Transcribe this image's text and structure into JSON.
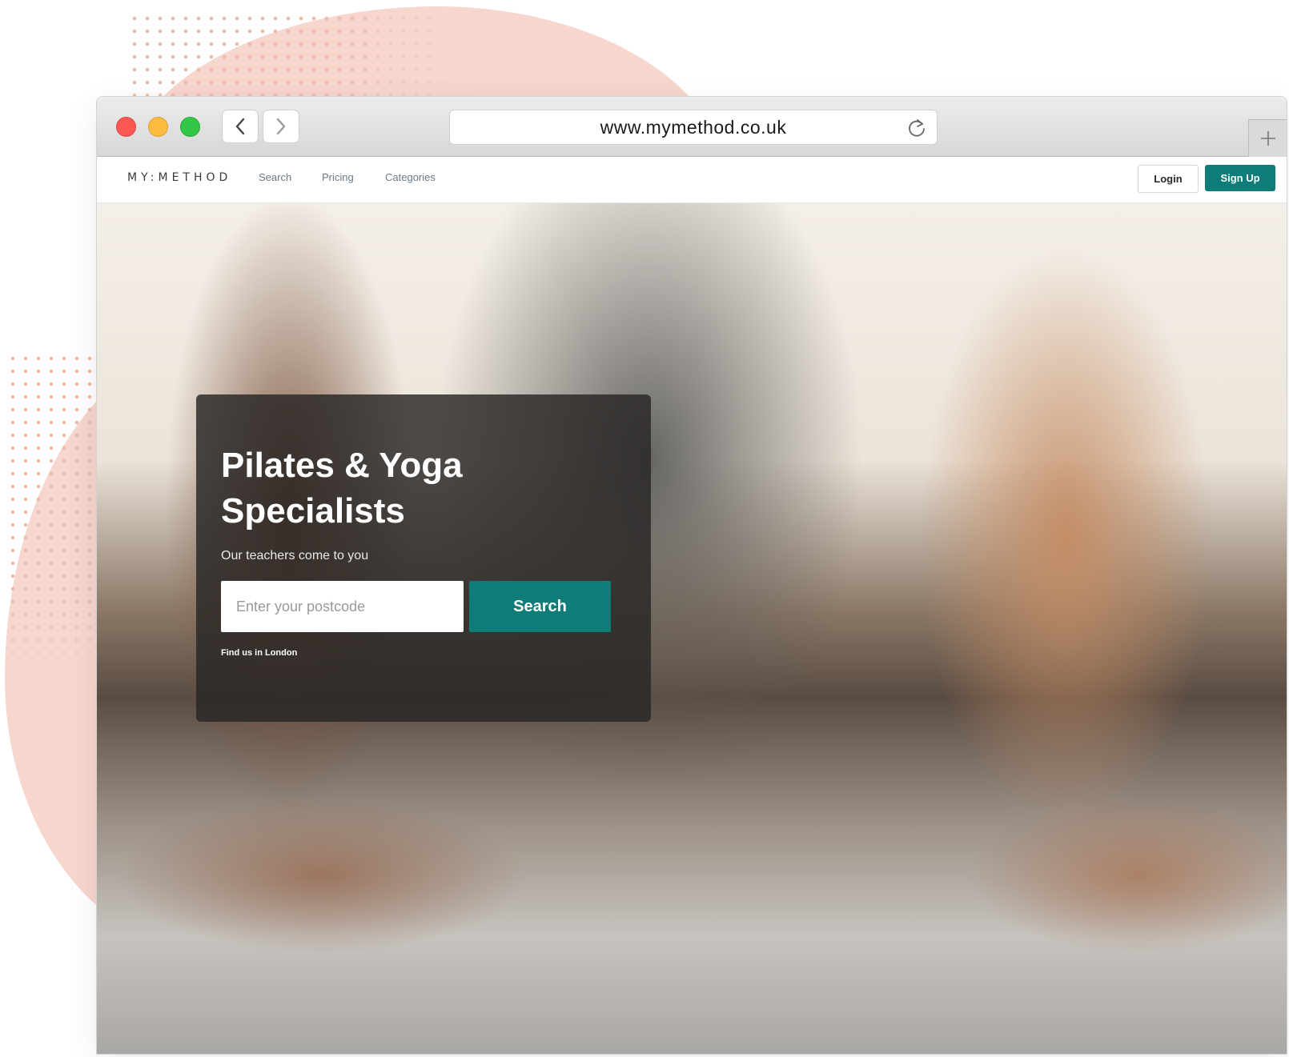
{
  "browser": {
    "url": "www.mymethod.co.uk",
    "icons": {
      "back": "chevron-left-icon",
      "forward": "chevron-right-icon",
      "reload": "reload-icon",
      "new_tab": "plus-icon"
    }
  },
  "site": {
    "logo": "MY:METHOD",
    "nav": {
      "search": "Search",
      "pricing": "Pricing",
      "categories": "Categories"
    },
    "login_label": "Login",
    "signup_label": "Sign Up"
  },
  "hero": {
    "title": "Pilates & Yoga Specialists",
    "subtitle": "Our teachers come to you",
    "postcode_placeholder": "Enter your postcode",
    "search_label": "Search",
    "find_link": "Find us in London"
  },
  "colors": {
    "brand_teal": "#0f7c79",
    "decor_pink": "#f6d6cd"
  }
}
